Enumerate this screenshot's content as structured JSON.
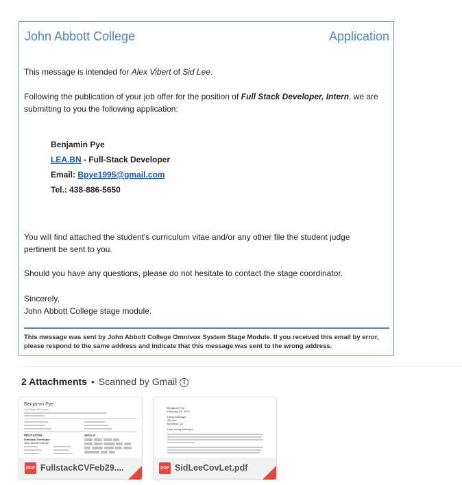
{
  "email": {
    "college_name": "John Abbott College",
    "header_right": "Application",
    "intro_prefix": "This message is intended for ",
    "recipient_name": "Alex Vibert",
    "intro_of": " of ",
    "company": "Sid Lee",
    "intro_end": ".",
    "pub_prefix": "Following the publication of your job offer for the position of ",
    "position": "Full Stack Developer, Intern",
    "pub_suffix": ", we are submitting to you the following application:",
    "signature": {
      "name": "Benjamin Pye",
      "org_link": "LEA.BN",
      "org_suffix": " - Full-Stack Developer",
      "email_label": "Email: ",
      "email": "Bpye1995@gmail.com",
      "tel": "Tel.: 438-886-5650"
    },
    "attached_text": "You will find attached the student's curriculum vitae and/or any other file the student judge pertinent be sent to you.",
    "questions_text": "Should you have any questions, please do not hesitate to contact the stage coordinator.",
    "closing": "Sincerely,",
    "closing_sig": "John Abbott College stage module.",
    "footer": "This message was sent by John Abbott College Omnivox System Stage Module. If you received this email by error, please respond to the same address and indicate that this message was sent to the wrong address."
  },
  "attachments": {
    "count_label": "2 Attachments",
    "separator": "•",
    "scan_label": "Scanned by Gmail",
    "info_icon": "ⓘ",
    "items": [
      {
        "name": "FullstackCVFeb29....",
        "type_badge": "PDF",
        "preview": {
          "name": "Benjamin Pye",
          "title": "Full Stack Developer",
          "education_head": "EDUCATION",
          "skills_head": "SKILLS",
          "degree": "Fullstack Developer",
          "school": "John Abbott College"
        }
      },
      {
        "name": "SidLeeCovLet.pdf",
        "type_badge": "PDF",
        "preview": {
          "l1": "Benjamin Pye",
          "l2": "February 29, 2024",
          "l3": "Hiring Manager",
          "l4": "Sid Lee",
          "l5": "Montréal, QC",
          "l6": "Dear Hiring Manager,"
        }
      }
    ]
  }
}
